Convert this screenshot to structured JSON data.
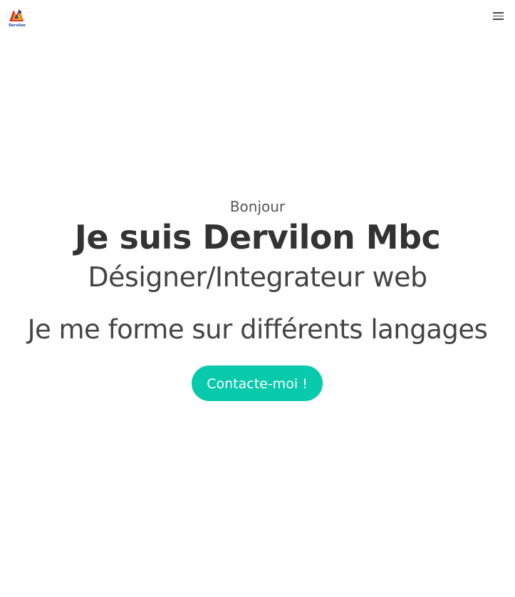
{
  "nav": {
    "logo_text": "Dervilon",
    "menu_icon": "hamburger-menu-icon"
  },
  "hero": {
    "greeting": "Bonjour",
    "headline": "Je suis Dervilon Mbc",
    "role": "Désigner/Integrateur web",
    "tagline": "Je me forme sur différents langages",
    "cta_label": "Contacte-moi !"
  },
  "colors": {
    "accent": "#07c9ac",
    "text": "#333333",
    "background": "#ffffff"
  }
}
